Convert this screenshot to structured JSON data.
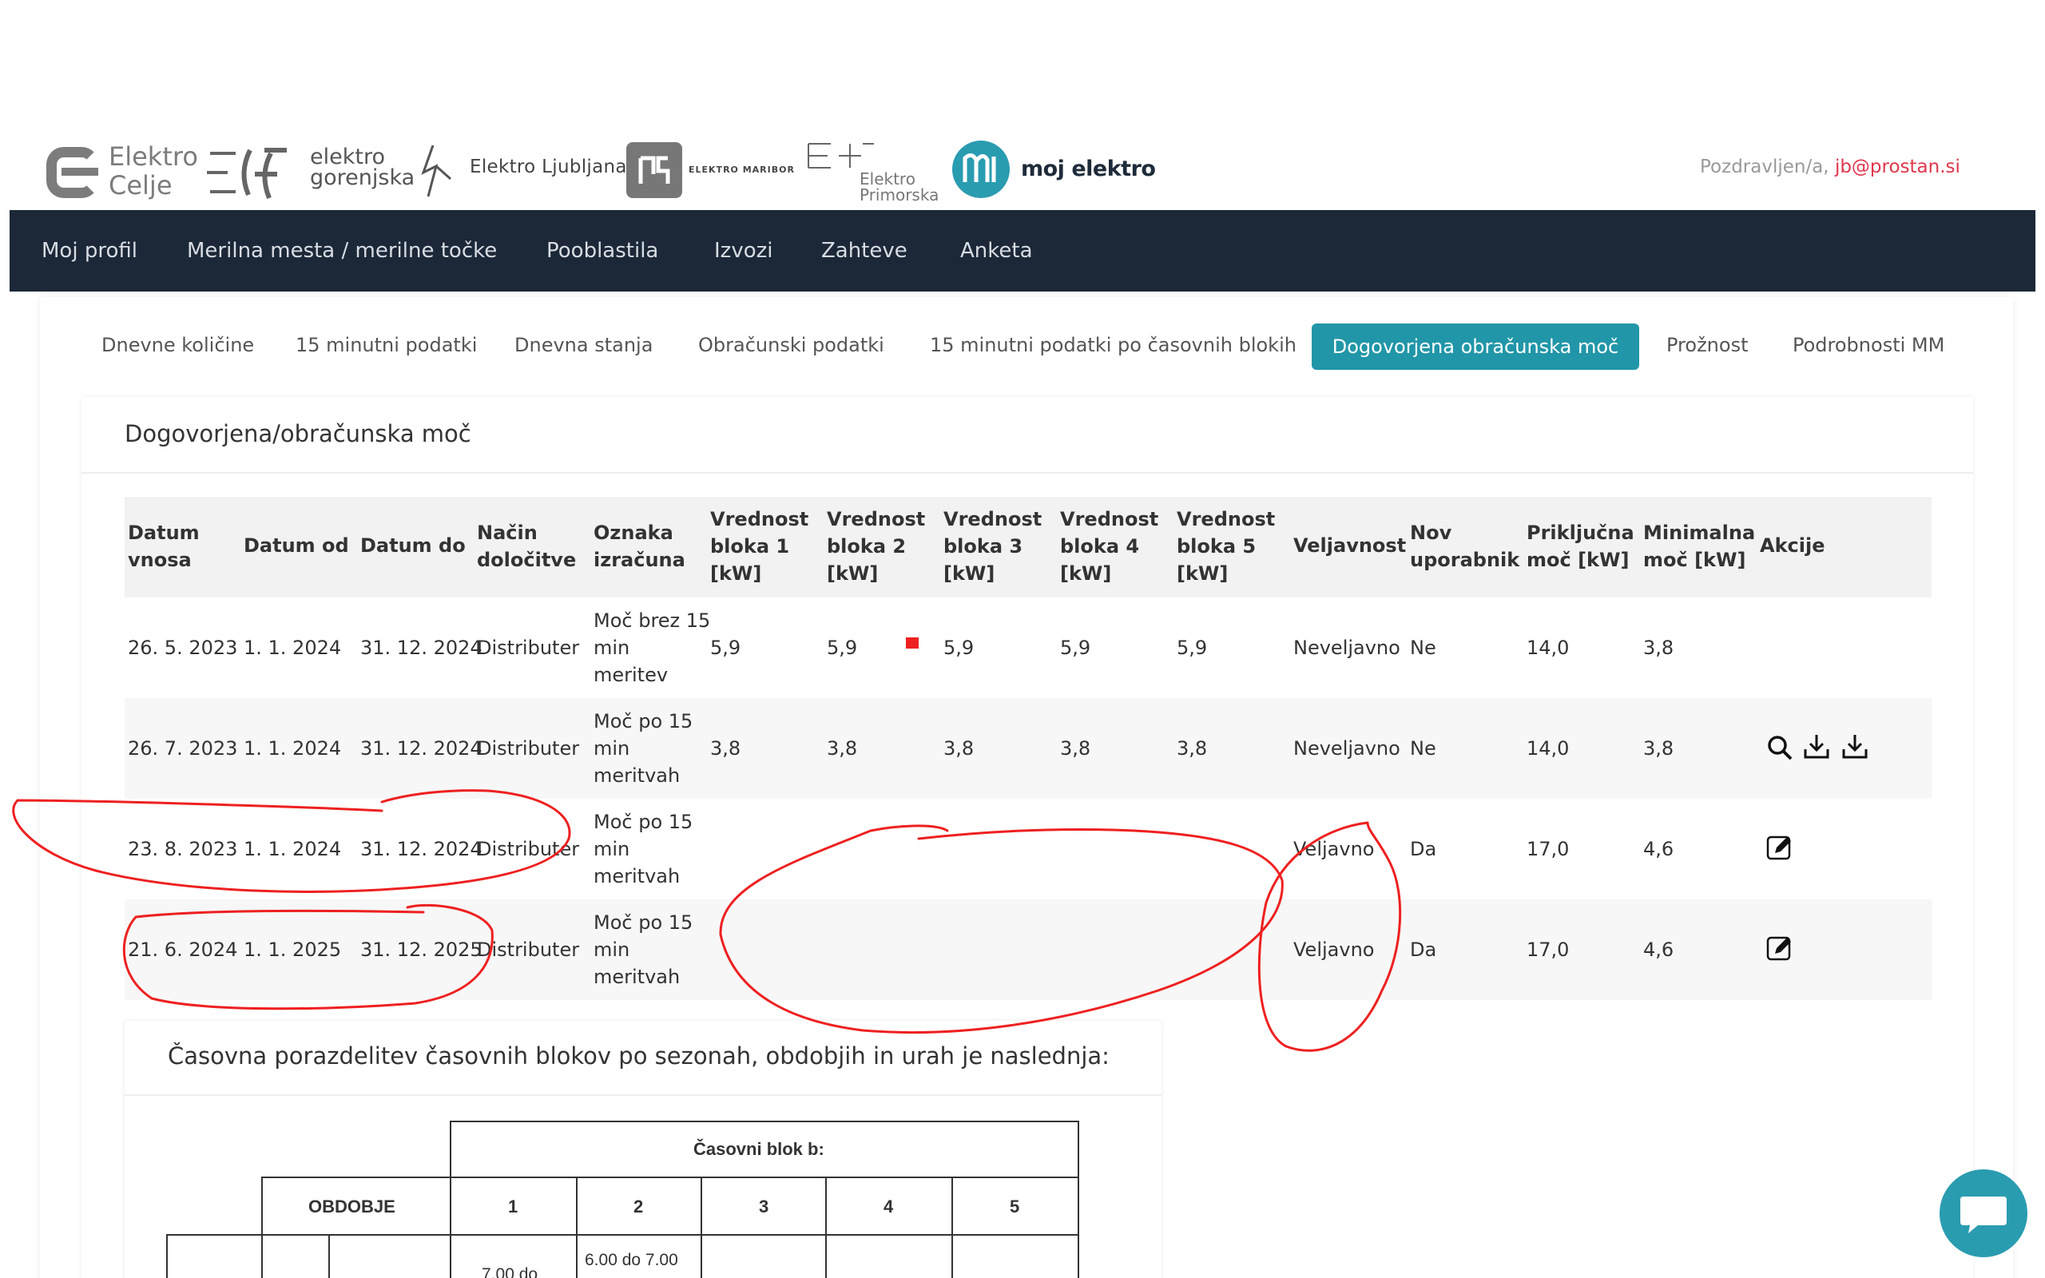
{
  "brand": {
    "celje": "Elektro Celje",
    "celje_l1": "Elektro",
    "celje_l2": "Celje",
    "gorenjska_l1": "elektro",
    "gorenjska_l2": "gorenjska",
    "ljubljana": "Elektro Ljubljana",
    "maribor": "ELEKTRO MARIBOR",
    "primorska_l1": "Elektro",
    "primorska_l2": "Primorska",
    "moj": "moj elektro"
  },
  "greeting": {
    "label": "Pozdravljen/a, ",
    "email": "jb@prostan.si"
  },
  "nav": {
    "items": [
      {
        "label": "Moj profil"
      },
      {
        "label": "Merilna mesta / merilne točke"
      },
      {
        "label": "Pooblastila"
      },
      {
        "label": "Izvozi"
      },
      {
        "label": "Zahteve"
      },
      {
        "label": "Anketa"
      }
    ]
  },
  "tabs": {
    "items": [
      {
        "label": "Dnevne količine"
      },
      {
        "label": "15 minutni podatki"
      },
      {
        "label": "Dnevna stanja"
      },
      {
        "label": "Obračunski podatki"
      },
      {
        "label": "15 minutni podatki po časovnih blokih"
      },
      {
        "label": "Dogovorjena obračunska moč"
      },
      {
        "label": "Prožnost"
      },
      {
        "label": "Podrobnosti MM"
      }
    ],
    "active": "Dogovorjena obračunska moč"
  },
  "panel": {
    "title": "Dogovorjena/obračunska moč"
  },
  "table": {
    "headers": [
      [
        "Datum",
        "vnosa"
      ],
      [
        "Datum od"
      ],
      [
        "Datum do"
      ],
      [
        "Način",
        "določitve"
      ],
      [
        "Oznaka",
        "izračuna"
      ],
      [
        "Vrednost",
        "bloka 1",
        "[kW]"
      ],
      [
        "Vrednost",
        "bloka 2",
        "[kW]"
      ],
      [
        "Vrednost",
        "bloka 3",
        "[kW]"
      ],
      [
        "Vrednost",
        "bloka 4",
        "[kW]"
      ],
      [
        "Vrednost",
        "bloka 5",
        "[kW]"
      ],
      [
        "Veljavnost"
      ],
      [
        "Nov",
        "uporabnik"
      ],
      [
        "Priključna",
        "moč [kW]"
      ],
      [
        "Minimalna",
        "moč [kW]"
      ],
      [
        "Akcije"
      ]
    ],
    "rows": [
      {
        "datum_vnosa": "26. 5. 2023",
        "od": "1. 1. 2024",
        "do": "31. 12. 2024",
        "nacin": "Distributer",
        "oznaka": [
          "Moč brez 15",
          "min",
          "meritev"
        ],
        "b1": "5,9",
        "b2": "5,9",
        "b3": "5,9",
        "b4": "5,9",
        "b5": "5,9",
        "veljavnost": "Neveljavno",
        "nov": "Ne",
        "prikljucna": "14,0",
        "minimalna": "3,8",
        "akcije": []
      },
      {
        "datum_vnosa": "26. 7. 2023",
        "od": "1. 1. 2024",
        "do": "31. 12. 2024",
        "nacin": "Distributer",
        "oznaka": [
          "Moč po 15",
          "min",
          "meritvah"
        ],
        "b1": "3,8",
        "b2": "3,8",
        "b3": "3,8",
        "b4": "3,8",
        "b5": "3,8",
        "veljavnost": "Neveljavno",
        "nov": "Ne",
        "prikljucna": "14,0",
        "minimalna": "3,8",
        "akcije": [
          "search-icon",
          "download-icon",
          "download-icon"
        ]
      },
      {
        "datum_vnosa": "23. 8. 2023",
        "od": "1. 1. 2024",
        "do": "31. 12. 2024",
        "nacin": "Distributer",
        "oznaka": [
          "Moč po 15",
          "min",
          "meritvah"
        ],
        "b1": "",
        "b2": "",
        "b3": "",
        "b4": "",
        "b5": "",
        "veljavnost": "Veljavno",
        "nov": "Da",
        "prikljucna": "17,0",
        "minimalna": "4,6",
        "akcije": [
          "edit-icon"
        ]
      },
      {
        "datum_vnosa": "21. 6. 2024",
        "od": "1. 1. 2025",
        "do": "31. 12. 2025",
        "nacin": "Distributer",
        "oznaka": [
          "Moč po 15",
          "min",
          "meritvah"
        ],
        "b1": "",
        "b2": "",
        "b3": "",
        "b4": "",
        "b5": "",
        "veljavnost": "Veljavno",
        "nov": "Da",
        "prikljucna": "17,0",
        "minimalna": "4,6",
        "akcije": [
          "edit-icon"
        ]
      }
    ]
  },
  "blocks": {
    "title": "Časovna porazdelitev časovnih blokov po sezonah, obdobjih in urah je naslednja:",
    "header": "Časovni blok b:",
    "obdobje": "OBDOBJE",
    "cols": [
      "1",
      "2",
      "3",
      "4",
      "5"
    ],
    "first_row_partial": {
      "c1": "7.00 do",
      "c2": "6.00 do 7.00"
    }
  },
  "colors": {
    "accent": "#2196a8",
    "nav_bg": "#1c2838",
    "email": "#e0364b",
    "annotation": "#ee2020"
  },
  "chat": {
    "icon": "chat-icon"
  }
}
